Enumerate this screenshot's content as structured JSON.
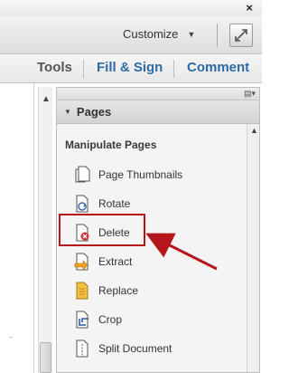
{
  "window": {
    "close_glyph": "×"
  },
  "toolbar": {
    "customize_label": "Customize",
    "caret": "▼"
  },
  "tabs": [
    {
      "label": "Tools"
    },
    {
      "label": "Fill & Sign"
    },
    {
      "label": "Comment"
    }
  ],
  "panel": {
    "header": "Pages",
    "collapse_glyph": "▼",
    "section": "Manipulate Pages",
    "options_glyph": "▤▾",
    "items": [
      {
        "label": "Page Thumbnails",
        "icon": "page-thumbnails-icon"
      },
      {
        "label": "Rotate",
        "icon": "rotate-icon"
      },
      {
        "label": "Delete",
        "icon": "delete-icon"
      },
      {
        "label": "Extract",
        "icon": "extract-icon"
      },
      {
        "label": "Replace",
        "icon": "replace-icon"
      },
      {
        "label": "Crop",
        "icon": "crop-icon"
      },
      {
        "label": "Split Document",
        "icon": "split-document-icon"
      }
    ]
  },
  "scroll": {
    "up_glyph": "▲"
  },
  "colors": {
    "accent": "#2c6aa8",
    "highlight": "#b4161a"
  }
}
